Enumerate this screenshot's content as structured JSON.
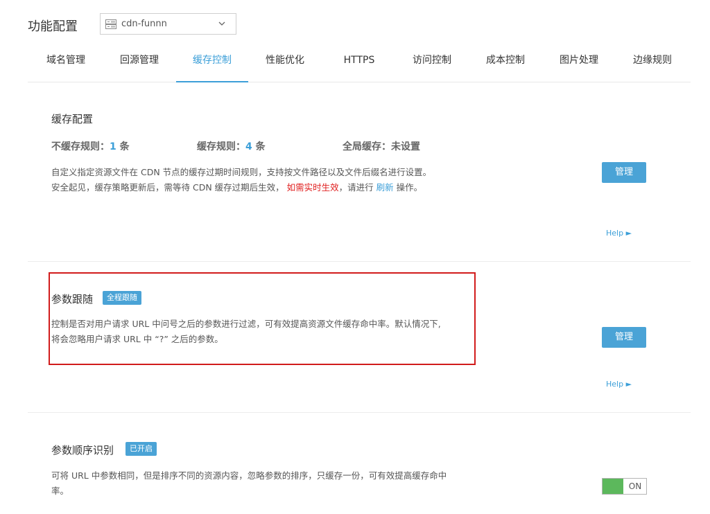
{
  "header": {
    "title": "功能配置",
    "domain_select": {
      "value": "cdn-funnn",
      "icon": "server-icon"
    }
  },
  "tabs": [
    {
      "label": "域名管理",
      "active": false
    },
    {
      "label": "回源管理",
      "active": false
    },
    {
      "label": "缓存控制",
      "active": true
    },
    {
      "label": "性能优化",
      "active": false
    },
    {
      "label": "HTTPS",
      "active": false
    },
    {
      "label": "访问控制",
      "active": false
    },
    {
      "label": "成本控制",
      "active": false
    },
    {
      "label": "图片处理",
      "active": false
    },
    {
      "label": "边缘规则",
      "active": false
    }
  ],
  "cache_config": {
    "title": "缓存配置",
    "no_cache_label": "不缓存规则：",
    "no_cache_count": "1",
    "no_cache_unit": "条",
    "cache_label": "缓存规则：",
    "cache_count": "4",
    "cache_unit": "条",
    "global_label": "全局缓存：",
    "global_value": "未设置",
    "desc1": "自定义指定资源文件在 CDN 节点的缓存过期时间规则，支持按文件路径以及文件后缀名进行设置。",
    "desc2_a": "安全起见，缓存策略更新后，需等待 CDN 缓存过期后生效，",
    "desc2_red": "如需实时生效",
    "desc2_b": "，请进行",
    "desc2_link": "刷新",
    "desc2_c": "操作。",
    "button": "管理",
    "help": "Help ►"
  },
  "param_follow": {
    "title": "参数跟随",
    "badge": "全程跟随",
    "desc1": "控制是否对用户请求 URL 中问号之后的参数进行过滤，可有效提高资源文件缓存命中率。默认情况下,",
    "desc2": "将会忽略用户请求 URL 中 “?” 之后的参数。",
    "button": "管理",
    "help": "Help ►"
  },
  "param_order": {
    "title": "参数顺序识别",
    "badge": "已开启",
    "desc1": "可将 URL 中参数相同，但是排序不同的资源内容，忽略参数的排序，只缓存一份，可有效提高缓存命中",
    "desc2": "率。",
    "toggle": "ON"
  },
  "colors": {
    "accent": "#3c9fd8",
    "highlight_border": "#d11b1b",
    "toggle_on": "#5cb85c"
  }
}
